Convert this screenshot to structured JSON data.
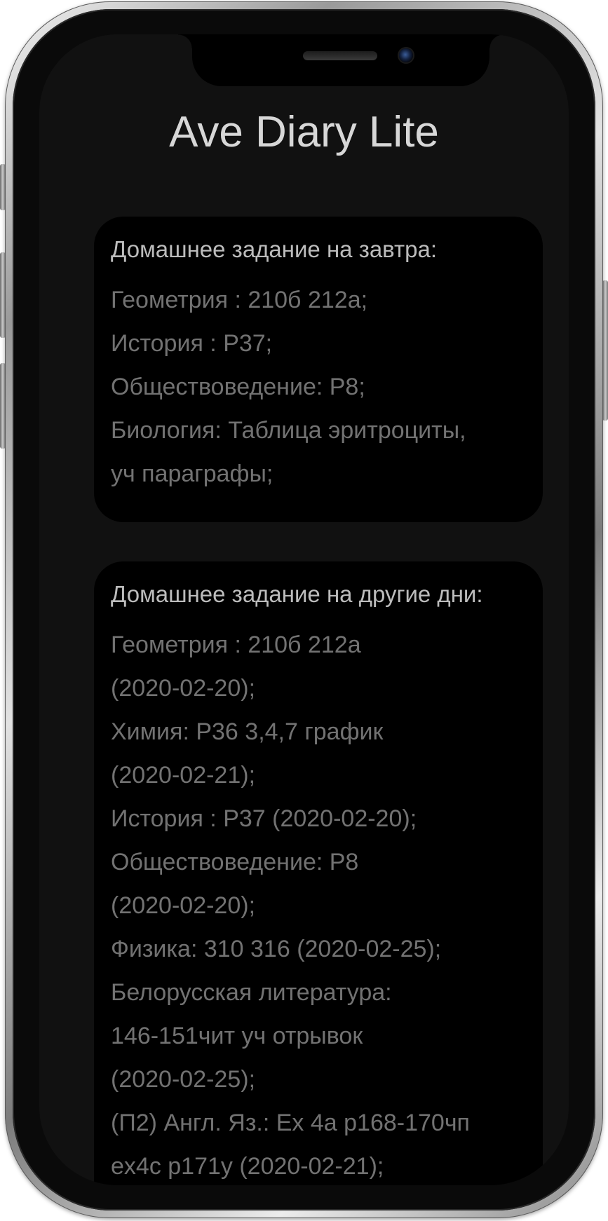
{
  "app": {
    "title": "Ave Diary Lite"
  },
  "tomorrow": {
    "heading": "Домашнее задание на завтра:",
    "lines": [
      "Геометрия : 210б 212а;",
      "История : Р37;",
      "Обществоведение: Р8;",
      "Биология: Таблица эритроциты,",
      "уч параграфы;"
    ]
  },
  "other_days": {
    "heading": "Домашнее задание на другие дни:",
    "lines": [
      "Геометрия : 210б 212а",
      "(2020-02-20);",
      "Химия: Р36 3,4,7 график",
      "(2020-02-21);",
      "История : Р37 (2020-02-20);",
      "Обществоведение: Р8",
      "(2020-02-20);",
      "Физика: 310 316 (2020-02-25);",
      "Белорусская литература:",
      "146-151чит уч отрывок",
      "(2020-02-25);",
      "(П2) Англ. Яз.: Ex 4a p168-170чп",
      "ex4c p171y (2020-02-21);"
    ]
  },
  "colors": {
    "screen_bg": "#111111",
    "card_bg": "#000000",
    "title_text": "#d7d7d7",
    "heading_text": "#bcbcbc",
    "body_text": "#727272"
  }
}
